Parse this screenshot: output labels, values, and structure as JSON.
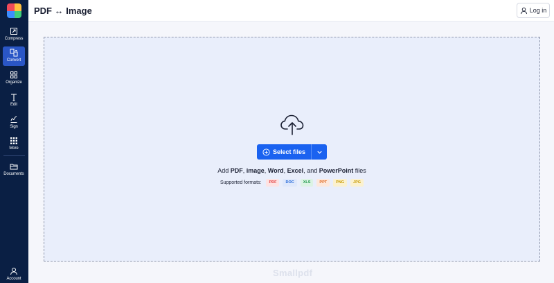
{
  "header": {
    "title": "PDF ↔ Image",
    "login_label": "Log in"
  },
  "sidebar": {
    "items": [
      {
        "label": "Compress",
        "icon": "compress-icon"
      },
      {
        "label": "Convert",
        "icon": "convert-icon",
        "active": true
      },
      {
        "label": "Organize",
        "icon": "organize-icon"
      },
      {
        "label": "Edit",
        "icon": "edit-icon"
      },
      {
        "label": "Sign",
        "icon": "sign-icon"
      },
      {
        "label": "More",
        "icon": "more-grid-icon"
      },
      {
        "label": "Documents",
        "icon": "documents-icon"
      }
    ],
    "account_label": "Account"
  },
  "dropzone": {
    "select_label": "Select files",
    "add_prefix": "Add ",
    "add_types": [
      "PDF",
      "image",
      "Word",
      "Excel",
      "PowerPoint"
    ],
    "add_sep1": ", ",
    "add_and": ", and ",
    "add_suffix": " files",
    "formats_label": "Supported formats:",
    "formats": [
      {
        "name": "PDF",
        "color": "#e23b3b",
        "bg": "#fde3e3"
      },
      {
        "name": "DOC",
        "color": "#2166d9",
        "bg": "#dfe8fb"
      },
      {
        "name": "XLS",
        "color": "#1e9a4b",
        "bg": "#dcf3e4"
      },
      {
        "name": "PPT",
        "color": "#e0661c",
        "bg": "#fde8dc"
      },
      {
        "name": "PNG",
        "color": "#c79a00",
        "bg": "#fbf1cf"
      },
      {
        "name": "JPG",
        "color": "#c79a00",
        "bg": "#fbf1cf"
      }
    ]
  },
  "brand": "Smallpdf",
  "colors": {
    "sidebar": "#0a1f44",
    "accent": "#1a62f0",
    "dropzone_bg": "#e9eefb"
  }
}
